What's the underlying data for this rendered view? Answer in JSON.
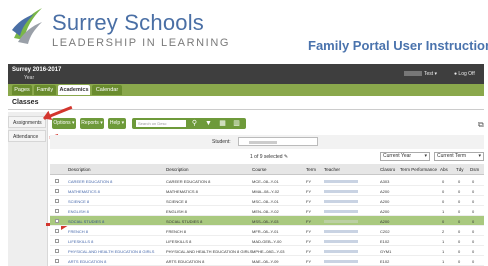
{
  "header": {
    "logo_title": "Surrey Schools",
    "logo_subtitle": "LEADERSHIP IN LEARNING",
    "doc_title": "Family Portal User Instructions"
  },
  "topbar": {
    "title": "Surrey 2016-2017",
    "subtitle": "Year",
    "user_suffix": "Test ▾",
    "logout": "● Log Off"
  },
  "nav_tabs": [
    {
      "label": "Pages",
      "active": false
    },
    {
      "label": "Family",
      "active": false
    },
    {
      "label": "Academics",
      "active": true
    },
    {
      "label": "Calendar",
      "active": false
    }
  ],
  "section_title": "Classes",
  "side_items": [
    "Assignments",
    "Attendance"
  ],
  "toolbar": {
    "options": "Options ▾",
    "reports": "Reports ▾",
    "help": "Help ▾",
    "search_placeholder": "Search on Desc"
  },
  "filter": {
    "label": "Student:"
  },
  "selection_info": "1 of 9 selected",
  "dropdowns": [
    "Current Year",
    "Current Term"
  ],
  "table": {
    "columns": [
      "Description",
      "Description",
      "Course",
      "Term",
      "Teacher",
      "Classro",
      "Term Performance",
      "Abs",
      "Tdy",
      "Dsm"
    ],
    "rows": [
      {
        "c1": "CAREER EDUCATION 8",
        "c2": "CAREER EDUCATION 8",
        "course": "MCE--08--Y-01",
        "term": "FY",
        "room": "A303",
        "abs": "0",
        "tdy": "0",
        "dsm": "0",
        "highlight": false
      },
      {
        "c1": "MATHEMATICS 8",
        "c2": "MATHEMATICS 8",
        "course": "MMA--08--Y-02",
        "term": "FY",
        "room": "A200",
        "abs": "0",
        "tdy": "0",
        "dsm": "0",
        "highlight": false
      },
      {
        "c1": "SCIENCE 8",
        "c2": "SCIENCE 8",
        "course": "MSC--08--Y-01",
        "term": "FY",
        "room": "A200",
        "abs": "0",
        "tdy": "0",
        "dsm": "0",
        "highlight": false
      },
      {
        "c1": "ENGLISH 8",
        "c2": "ENGLISH 8",
        "course": "MEN--08--Y-02",
        "term": "FY",
        "room": "A200",
        "abs": "1",
        "tdy": "0",
        "dsm": "0",
        "highlight": false
      },
      {
        "c1": "SOCIAL STUDIES 8",
        "c2": "SOCIAL STUDIES 8",
        "course": "MSS--08--Y-03",
        "term": "FY",
        "room": "A200",
        "abs": "0",
        "tdy": "0",
        "dsm": "0",
        "highlight": true
      },
      {
        "c1": "FRENCH 8",
        "c2": "FRENCH 8",
        "course": "MFR--08--Y-01",
        "term": "FY",
        "room": "C202",
        "abs": "2",
        "tdy": "0",
        "dsm": "0",
        "highlight": false
      },
      {
        "c1": "LIFESKILLS 8",
        "c2": "LIFESKILLS 8",
        "course": "MAD-GEB--Y-00",
        "term": "FY",
        "room": "E102",
        "abs": "1",
        "tdy": "0",
        "dsm": "0",
        "highlight": false
      },
      {
        "c1": "PHYSICAL AND HEALTH EDUCATION 8 GIRLS",
        "c2": "PHYSICAL AND HEALTH EDUCATION 8 GIRLS",
        "course": "MPHE--08G--Y-03",
        "term": "FY",
        "room": "GYM1",
        "abs": "1",
        "tdy": "0",
        "dsm": "0",
        "highlight": false
      },
      {
        "c1": "ARTS EDUCATION 8",
        "c2": "ARTS EDUCATION 8",
        "course": "MAE--08--Y-09",
        "term": "FY",
        "room": "E102",
        "abs": "1",
        "tdy": "0",
        "dsm": "0",
        "highlight": false
      }
    ]
  },
  "colors": {
    "topbar": "#3e3e3e",
    "tabbar": "#8aa84c",
    "highlight_row": "#a9c97f",
    "arrow": "#d3362e",
    "doc_title": "#4a73ad"
  }
}
